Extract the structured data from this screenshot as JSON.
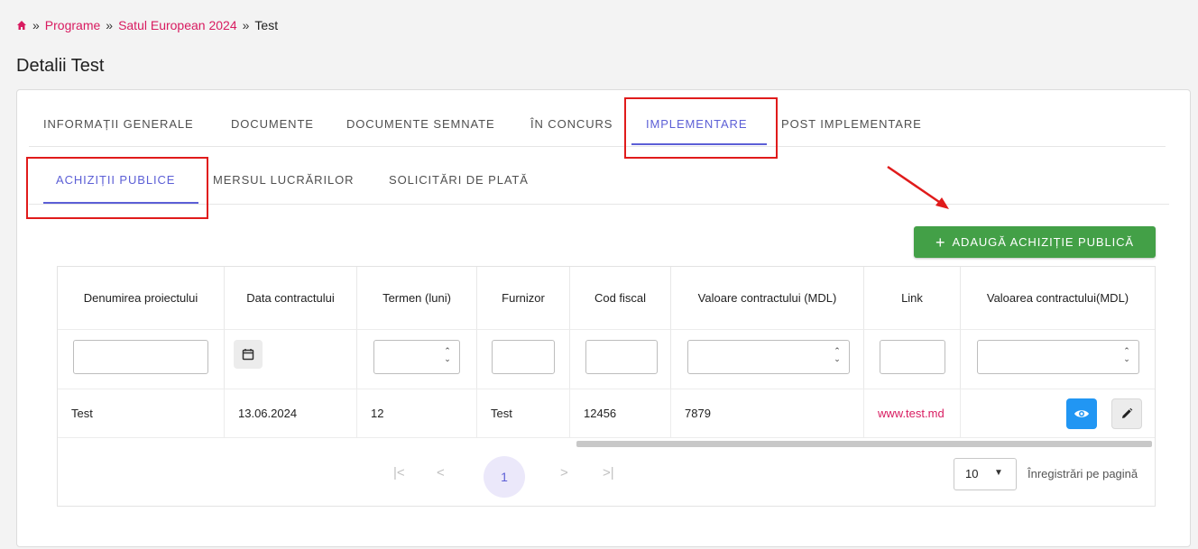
{
  "breadcrumb": {
    "home_icon": "home-icon",
    "separator": "»",
    "items": [
      "Programe",
      "Satul European 2024"
    ],
    "current": "Test"
  },
  "page_title": "Detalii Test",
  "tabs": [
    {
      "label": "INFORMAȚII GENERALE"
    },
    {
      "label": "DOCUMENTE"
    },
    {
      "label": "DOCUMENTE SEMNATE"
    },
    {
      "label": "ÎN CONCURS"
    },
    {
      "label": "IMPLEMENTARE",
      "active": true
    },
    {
      "label": "POST IMPLEMENTARE"
    }
  ],
  "subtabs": [
    {
      "label": "ACHIZIȚII PUBLICE",
      "active": true
    },
    {
      "label": "MERSUL LUCRĂRILOR"
    },
    {
      "label": "SOLICITĂRI DE PLATĂ"
    }
  ],
  "add_button": {
    "icon": "+",
    "label": "ADAUGĂ ACHIZIȚIE PUBLICĂ"
  },
  "table": {
    "columns": [
      "Denumirea proiectului",
      "Data contractului",
      "Termen (luni)",
      "Furnizor",
      "Cod fiscal",
      "Valoare contractului (MDL)",
      "Link",
      "Valoarea contractului(MDL)"
    ],
    "rows": [
      {
        "name": "Test",
        "date": "13.06.2024",
        "term": "12",
        "supplier": "Test",
        "fiscal_code": "12456",
        "value": "7879",
        "link": "www.test.md"
      }
    ]
  },
  "pagination": {
    "first": "|<",
    "prev": "<",
    "current_page": "1",
    "next": ">",
    "last": ">|",
    "per_page": "10",
    "per_page_label": "Înregistrări pe pagină"
  },
  "colors": {
    "accent": "#5c5fd6",
    "link": "#d81b60",
    "add_button": "#43a047",
    "view_button": "#2196f3",
    "annotation": "#e01b1b"
  }
}
